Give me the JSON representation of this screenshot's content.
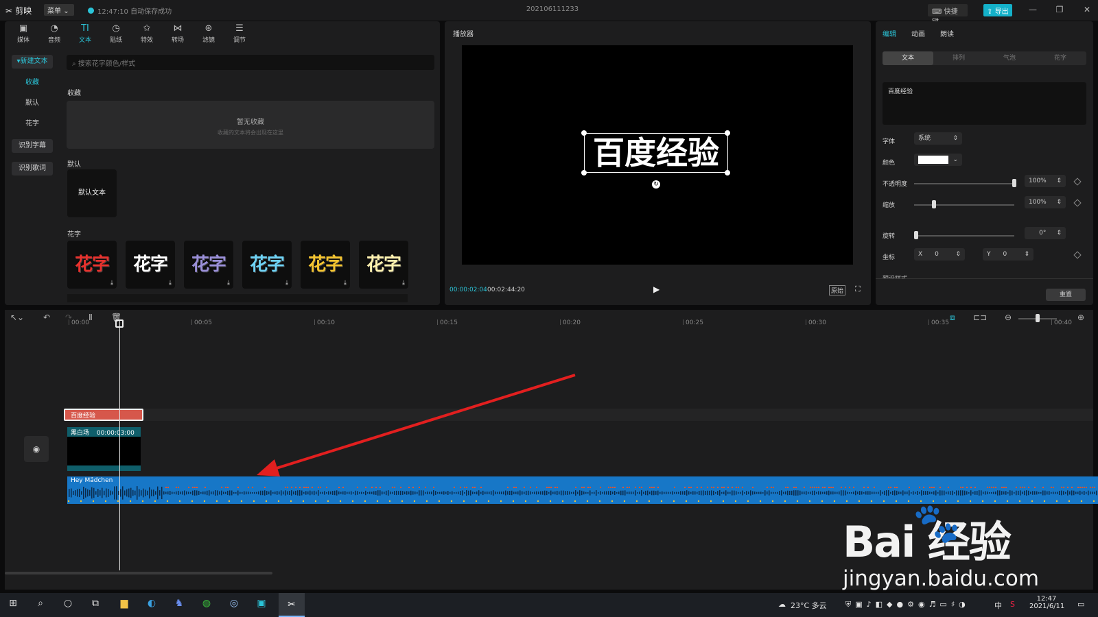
{
  "titlebar": {
    "app_name": "剪映",
    "menu_label": "菜单",
    "save_status": "12:47:10 自动保存成功",
    "project_title": "202106111233",
    "shortcut_label": "快捷键",
    "export_label": "导出"
  },
  "toolbar": {
    "items": [
      {
        "label": "媒体",
        "icon": "media-icon"
      },
      {
        "label": "音频",
        "icon": "audio-icon"
      },
      {
        "label": "文本",
        "icon": "text-icon"
      },
      {
        "label": "贴纸",
        "icon": "sticker-icon"
      },
      {
        "label": "特效",
        "icon": "effects-icon"
      },
      {
        "label": "转场",
        "icon": "transition-icon"
      },
      {
        "label": "滤镜",
        "icon": "filter-icon"
      },
      {
        "label": "调节",
        "icon": "adjust-icon"
      }
    ]
  },
  "sidebar": {
    "new_text": "新建文本",
    "items": [
      "收藏",
      "默认",
      "花字"
    ],
    "recognize_subtitles": "识别字幕",
    "recognize_lyrics": "识别歌词"
  },
  "library": {
    "search_placeholder": "搜索花字颜色/样式",
    "favorites_title": "收藏",
    "favorites_empty": "暂无收藏",
    "favorites_hint": "收藏的文本将会出现在这里",
    "default_title": "默认",
    "default_text": "默认文本",
    "huazi_title": "花字",
    "huazi_label": "花字",
    "huazi_colors": [
      "#e8322e",
      "#ffffff",
      "#9a8fd8",
      "#6fd3f5",
      "#f5c531",
      "#fff2b0"
    ]
  },
  "player": {
    "title": "播放器",
    "overlay_text": "百度经验",
    "current_time": "00:00:02:04",
    "total_time": "00:02:44:20",
    "ratio_label": "原始"
  },
  "properties": {
    "tabs": [
      "编辑",
      "动画",
      "朗读"
    ],
    "subtabs": [
      "文本",
      "排列",
      "气泡",
      "花字"
    ],
    "text_value": "百度经验",
    "font_label": "字体",
    "font_value": "系统",
    "color_label": "颜色",
    "color_value": "#ffffff",
    "opacity_label": "不透明度",
    "opacity_value": "100%",
    "opacity_level": 1.0,
    "scale_label": "缩放",
    "scale_value": "100%",
    "scale_level": 0.2,
    "rotate_label": "旋转",
    "rotate_value": "0°",
    "position_label": "坐标",
    "x_label": "X",
    "x_value": "0",
    "y_label": "Y",
    "y_value": "0",
    "preset_label": "预设样式",
    "reset_label": "重置"
  },
  "timeline": {
    "ticks": [
      "00:00",
      "00:05",
      "00:10",
      "00:15",
      "00:20",
      "00:25",
      "00:30",
      "00:35",
      "00:40"
    ],
    "text_clip_label": "百度经验",
    "video_clip_name": "黑白场",
    "video_clip_duration": "00:00:03:00",
    "audio_clip_name": "Hey Mädchen",
    "accent_audio": "#1777c7",
    "accent_text_clip": "#d6574b"
  },
  "taskbar": {
    "weather": "23°C 多云",
    "ime": "中",
    "time": "12:47",
    "date": "2021/6/11"
  },
  "watermark": {
    "line1": "Bai  经验",
    "line2": "jingyan.baidu.com"
  }
}
